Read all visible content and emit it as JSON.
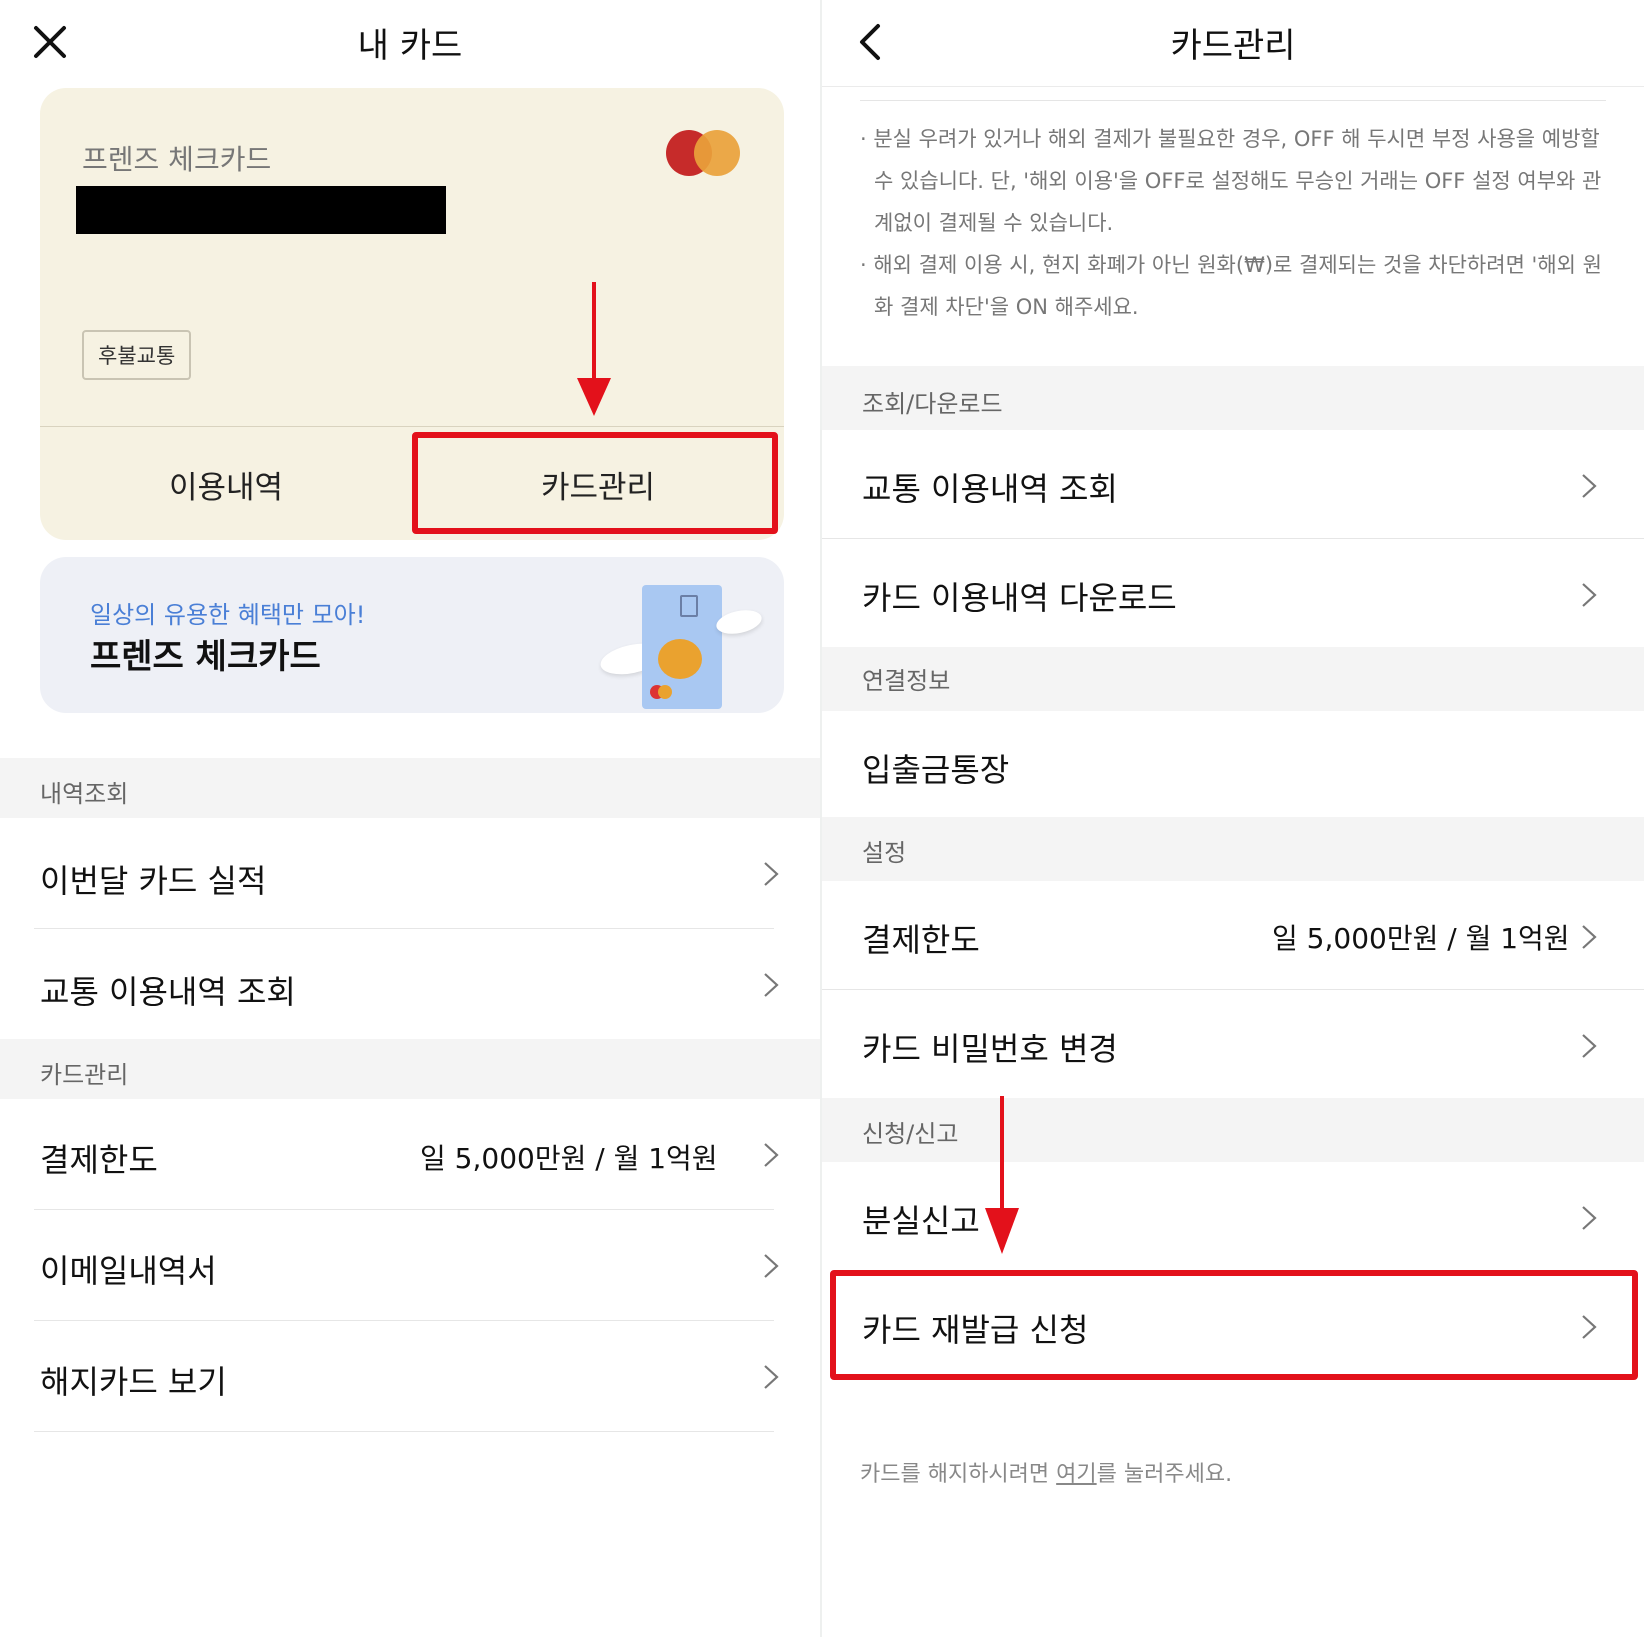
{
  "left": {
    "header": {
      "title": "내 카드"
    },
    "card": {
      "name": "프렌즈 체크카드",
      "badge": "후불교통",
      "actions": {
        "history": "이용내역",
        "manage": "카드관리"
      }
    },
    "banner": {
      "subtitle": "일상의 유용한 혜택만 모아!",
      "title": "프렌즈 체크카드"
    },
    "sections": [
      {
        "title": "내역조회",
        "rows": [
          {
            "label": "이번달 카드 실적"
          },
          {
            "label": "교통 이용내역 조회"
          }
        ]
      },
      {
        "title": "카드관리",
        "rows": [
          {
            "label": "결제한도",
            "value": "일 5,000만원 / 월 1억원"
          },
          {
            "label": "이메일내역서"
          },
          {
            "label": "해지카드 보기"
          }
        ]
      }
    ]
  },
  "right": {
    "header": {
      "title": "카드관리"
    },
    "notice": [
      "· 분실 우려가 있거나 해외 결제가 불필요한 경우, OFF 해 두시면 부정 사용을 예방할 수 있습니다. 단, '해외 이용'을 OFF로 설정해도 무승인 거래는 OFF 설정 여부와 관계없이 결제될 수 있습니다.",
      "· 해외 결제 이용 시, 현지 화폐가 아닌 원화(₩)로 결제되는 것을 차단하려면 '해외 원화 결제 차단'을 ON 해주세요."
    ],
    "sections": [
      {
        "title": "조회/다운로드",
        "rows": [
          {
            "label": "교통 이용내역 조회"
          },
          {
            "label": "카드 이용내역 다운로드"
          }
        ]
      },
      {
        "title": "연결정보",
        "rows": [
          {
            "label": "입출금통장"
          }
        ]
      },
      {
        "title": "설정",
        "rows": [
          {
            "label": "결제한도",
            "value": "일 5,000만원 / 월 1억원"
          },
          {
            "label": "카드 비밀번호 변경"
          }
        ]
      },
      {
        "title": "신청/신고",
        "rows": [
          {
            "label": "분실신고"
          },
          {
            "label": "카드 재발급 신청"
          }
        ]
      }
    ],
    "footer": {
      "before": "카드를 해지하시려면 ",
      "link": "여기",
      "after": "를 눌러주세요."
    }
  },
  "colors": {
    "highlight": "#e3111b",
    "card_bg": "#f6f2e2",
    "banner_bg": "#eef0f6",
    "banner_accent": "#4a7fd6"
  }
}
